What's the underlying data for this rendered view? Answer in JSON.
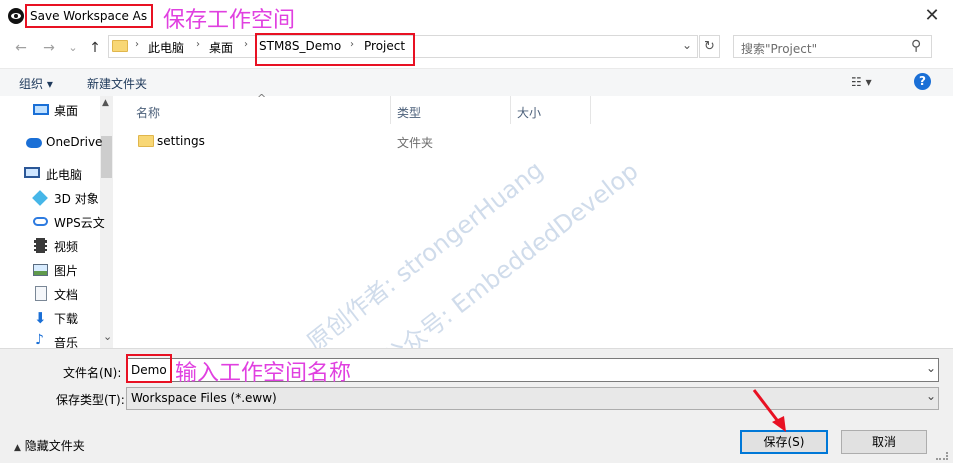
{
  "window": {
    "title": "Save Workspace As",
    "close_glyph": "✕"
  },
  "annotations": {
    "title_note": "保存工作空间",
    "filename_note": "输入工作空间名称",
    "color": "#e040e0"
  },
  "nav": {
    "back_glyph": "←",
    "forward_glyph": "→",
    "recent_glyph": "⌄",
    "up_glyph": "↑",
    "breadcrumbs": [
      "此电脑",
      "桌面",
      "STM8S_Demo",
      "Project"
    ],
    "crumb_sep": "›",
    "dropdown_glyph": "⌄",
    "refresh_glyph": "↻",
    "search_placeholder": "搜索\"Project\"",
    "search_glyph": "⚲"
  },
  "toolbar": {
    "organize": "组织 ▾",
    "new_folder": "新建文件夹",
    "view_glyph": "☷ ▾",
    "help": "?"
  },
  "sidebar": {
    "items": [
      {
        "label": "桌面",
        "icon": "desktop-icon"
      },
      {
        "label": "OneDrive",
        "icon": "cloud-icon"
      },
      {
        "label": "此电脑",
        "icon": "computer-icon"
      },
      {
        "label": "3D 对象",
        "icon": "cube-icon"
      },
      {
        "label": "WPS云文",
        "icon": "cloud-icon"
      },
      {
        "label": "视频",
        "icon": "video-icon"
      },
      {
        "label": "图片",
        "icon": "picture-icon"
      },
      {
        "label": "文档",
        "icon": "document-icon"
      },
      {
        "label": "下载",
        "icon": "download-icon"
      },
      {
        "label": "音乐",
        "icon": "music-icon"
      }
    ],
    "scroll_down_glyph": "⌄"
  },
  "list": {
    "columns": {
      "name": "名称",
      "type": "类型",
      "size": "大小"
    },
    "sort_glyph": "^",
    "rows": [
      {
        "name": "settings",
        "type": "文件夹",
        "size": ""
      }
    ]
  },
  "watermark": {
    "line1": "原创作者: strongerHuang",
    "line2": "微信公众号: EmbeddedDevelop"
  },
  "form": {
    "filename_label": "文件名(N):",
    "filename_value": "Demo",
    "filetype_label": "保存类型(T):",
    "filetype_value": "Workspace Files (*.eww)",
    "combo_glyph": "⌄"
  },
  "footer": {
    "hide_folders": "隐藏文件夹",
    "hide_glyph": "▲",
    "save_button": "保存(S)",
    "cancel_button": "取消"
  }
}
